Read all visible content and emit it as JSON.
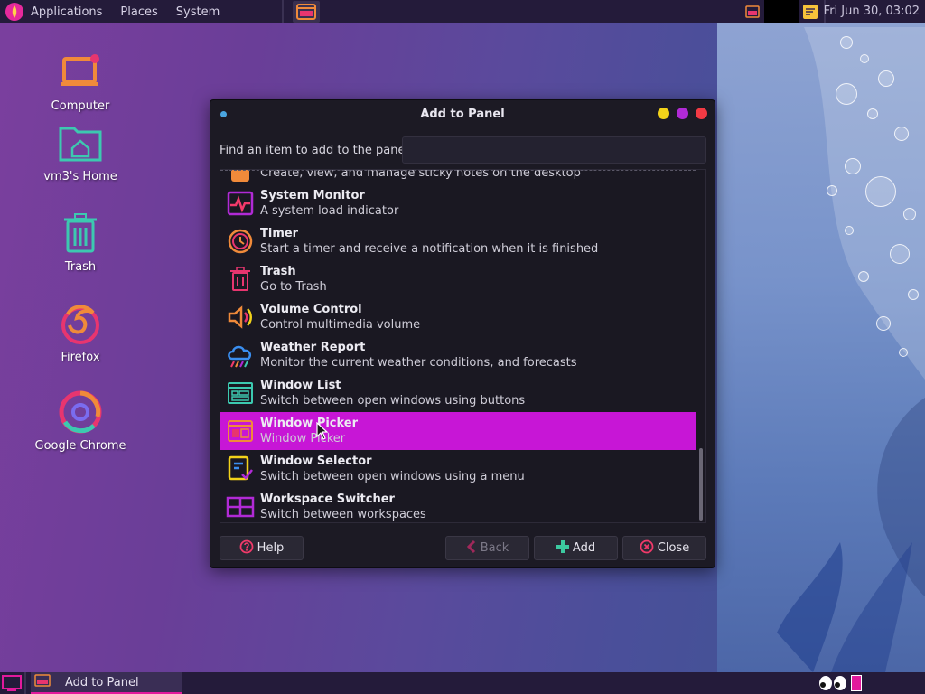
{
  "top_panel": {
    "menus": [
      "Applications",
      "Places",
      "System"
    ],
    "clock": "Fri Jun 30, 03:02"
  },
  "desktop_icons": [
    {
      "label": "Computer",
      "icon": "computer-icon"
    },
    {
      "label": "vm3's Home",
      "icon": "home-folder-icon"
    },
    {
      "label": "Trash",
      "icon": "trash-icon"
    },
    {
      "label": "Firefox",
      "icon": "firefox-icon"
    },
    {
      "label": "Google Chrome",
      "icon": "chrome-icon"
    }
  ],
  "dialog": {
    "title": "Add to Panel",
    "find_label": "Find an item to add to the panel:",
    "find_value": "",
    "items": [
      {
        "name": "",
        "desc": "Create, view, and manage sticky notes on the desktop",
        "icon": "sticky-notes-icon"
      },
      {
        "name": "System Monitor",
        "desc": "A system load indicator",
        "icon": "system-monitor-icon"
      },
      {
        "name": "Timer",
        "desc": "Start a timer and receive a notification when it is finished",
        "icon": "timer-icon"
      },
      {
        "name": "Trash",
        "desc": "Go to Trash",
        "icon": "trash-icon"
      },
      {
        "name": "Volume Control",
        "desc": "Control multimedia volume",
        "icon": "volume-icon"
      },
      {
        "name": "Weather Report",
        "desc": "Monitor the current weather conditions, and forecasts",
        "icon": "weather-icon"
      },
      {
        "name": "Window List",
        "desc": "Switch between open windows using buttons",
        "icon": "window-list-icon"
      },
      {
        "name": "Window Picker",
        "desc": "Window Picker",
        "icon": "window-picker-icon",
        "selected": true
      },
      {
        "name": "Window Selector",
        "desc": "Switch between open windows using a menu",
        "icon": "window-selector-icon"
      },
      {
        "name": "Workspace Switcher",
        "desc": "Switch between workspaces",
        "icon": "workspace-switcher-icon"
      }
    ],
    "buttons": {
      "help": "Help",
      "back": "Back",
      "add": "Add",
      "close": "Close"
    }
  },
  "taskbar": {
    "task_label": "Add to Panel"
  },
  "colors": {
    "selection": "#c716d6",
    "panel": "#241b3a",
    "dialog_bg": "#1c1a24"
  }
}
